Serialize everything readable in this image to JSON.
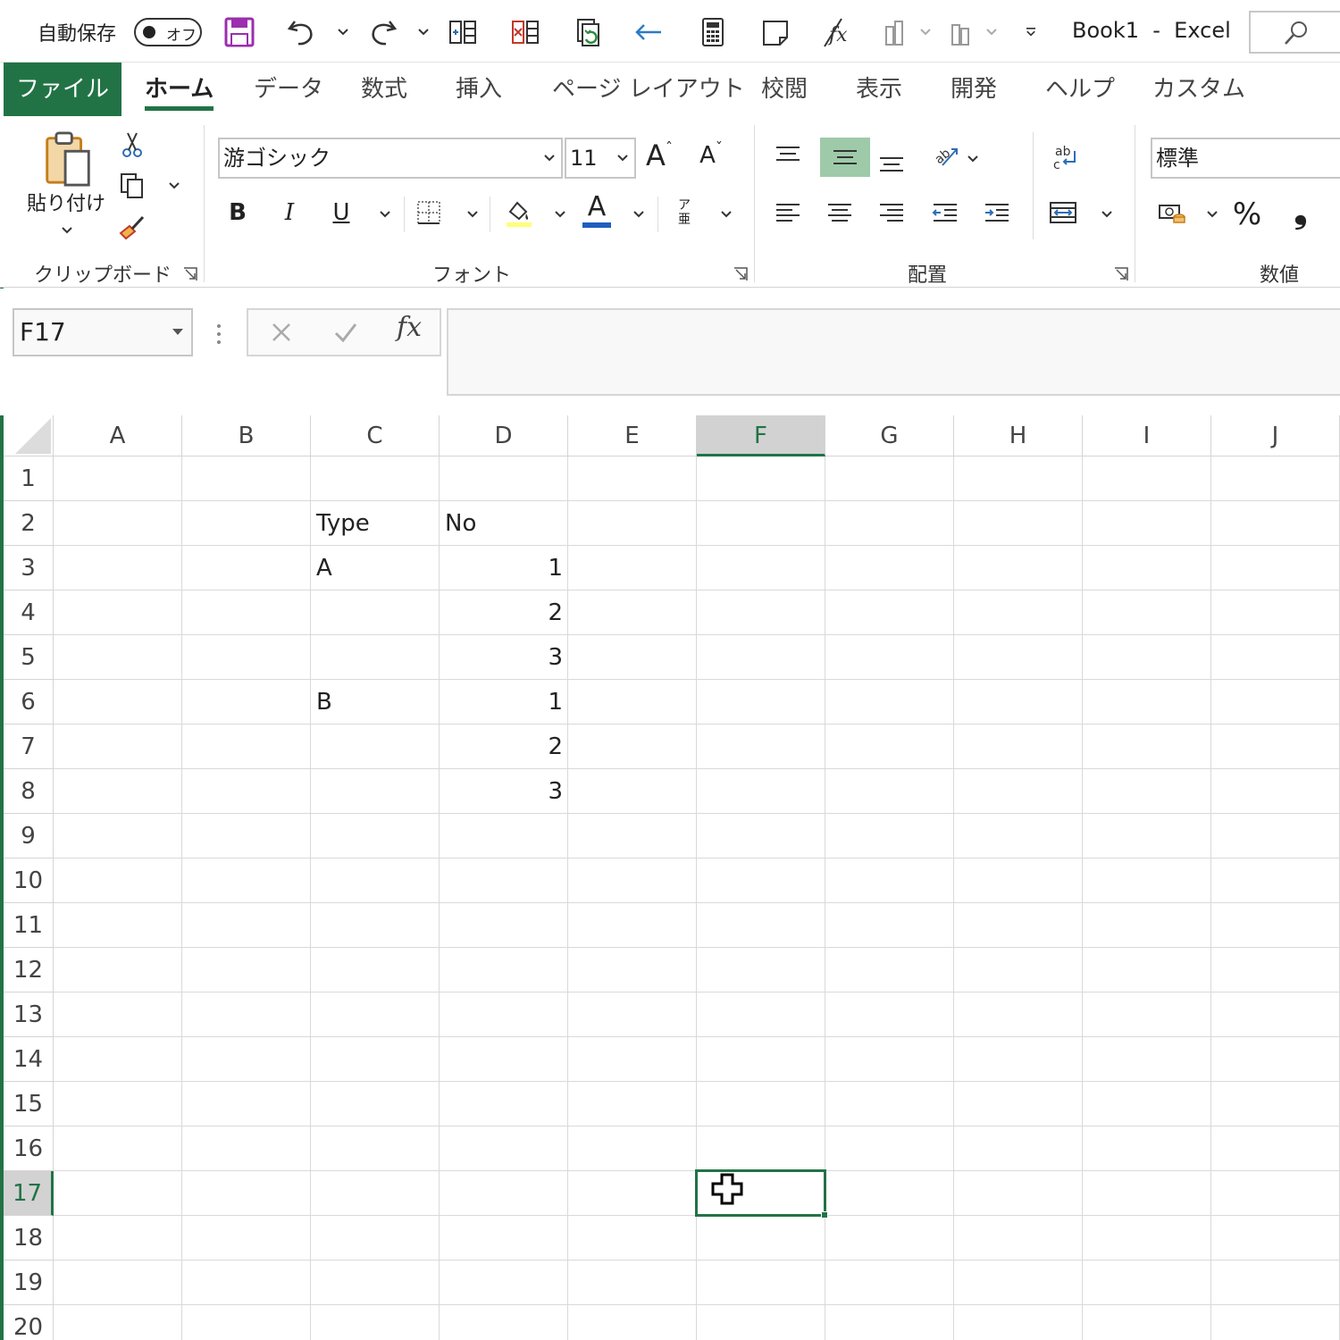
{
  "titlebar": {
    "autosave_label": "自動保存",
    "autosave_state": "オフ",
    "document_title": "Book1  -  Excel"
  },
  "tabs": [
    {
      "label": "ファイル"
    },
    {
      "label": "ホーム"
    },
    {
      "label": "データ"
    },
    {
      "label": "数式"
    },
    {
      "label": "挿入"
    },
    {
      "label": "ページ レイアウト"
    },
    {
      "label": "校閲"
    },
    {
      "label": "表示"
    },
    {
      "label": "開発"
    },
    {
      "label": "ヘルプ"
    },
    {
      "label": "カスタム"
    }
  ],
  "ribbon": {
    "clipboard": {
      "label": "クリップボード",
      "paste_label": "貼り付け"
    },
    "font": {
      "label": "フォント",
      "font_name": "游ゴシック",
      "font_size": "11",
      "bold": "B",
      "italic": "I",
      "underline": "U",
      "grow": "A",
      "shrink": "A",
      "font_color": "A",
      "furigana_top": "ア",
      "furigana_bottom": "亜"
    },
    "alignment": {
      "label": "配置",
      "wrap_top": "ab",
      "wrap_bottom": "c"
    },
    "number": {
      "label": "数値",
      "format": "標準",
      "percent": "%",
      "comma": "❟"
    }
  },
  "formula_bar": {
    "name_box": "F17",
    "fx": "fx",
    "content": ""
  },
  "colors": {
    "accent": "#217346",
    "selected_header": "#d2d2d2",
    "active_align": "#9ecaa9"
  },
  "grid": {
    "columns": [
      "A",
      "B",
      "C",
      "D",
      "E",
      "F",
      "G",
      "H",
      "I",
      "J"
    ],
    "rows": [
      "1",
      "2",
      "3",
      "4",
      "5",
      "6",
      "7",
      "8",
      "9",
      "10",
      "11",
      "12",
      "13",
      "14",
      "15",
      "16",
      "17",
      "18",
      "19",
      "20"
    ],
    "selected_cell": "F17",
    "cells": {
      "C2": "Type",
      "D2": "No",
      "C3": "A",
      "D3": "1",
      "D4": "2",
      "D5": "3",
      "C6": "B",
      "D6": "1",
      "D7": "2",
      "D8": "3"
    }
  }
}
